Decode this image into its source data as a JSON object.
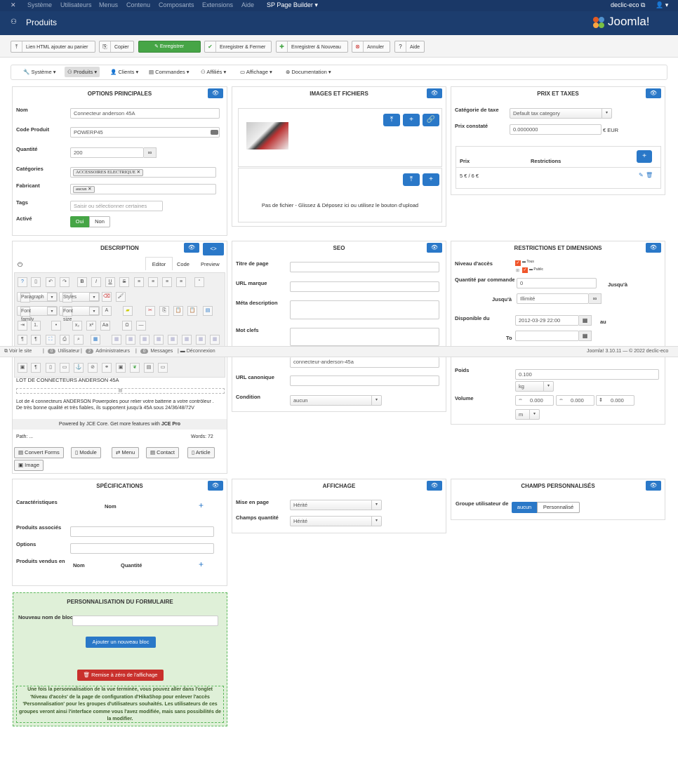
{
  "topbar": {
    "joomla_icon": "joomla-icon",
    "menu": [
      "Système",
      "Utilisateurs",
      "Menus",
      "Contenu",
      "Composants",
      "Extensions",
      "Aide"
    ],
    "sppb": "SP Page Builder",
    "site": "declic-eco",
    "user_icon": "user-icon"
  },
  "header": {
    "title": "Produits",
    "brand": "Joomla!"
  },
  "toolbar": {
    "html_cart": "Lien HTML ajouter au panier",
    "copy": "Copier",
    "save": "Enregistrer",
    "save_close": "Enregistrer & Fermer",
    "save_new": "Enregistrer & Nouveau",
    "cancel": "Annuler",
    "help": "Aide"
  },
  "nav": {
    "system": "Système",
    "products": "Produits",
    "clients": "Clients",
    "orders": "Commandes",
    "affiliates": "Affiliés",
    "display": "Affichage",
    "docs": "Documentation"
  },
  "main": {
    "title": "OPTIONS PRINCIPALES",
    "name_label": "Nom",
    "name_value": "Connecteur anderson 45A",
    "code_label": "Code Produit",
    "code_value": "POWERP45",
    "qty_label": "Quantité",
    "qty_value": "200",
    "cat_label": "Catégories",
    "cat_tag": "ACCESSOIRES ELECTRIQUE",
    "manuf_label": "Fabricant",
    "manuf_tag": "aucun",
    "tags_label": "Tags",
    "tags_placeholder": "Saisir ou sélectionner certaines",
    "active_label": "Activé",
    "yes": "Oui",
    "no": "Non"
  },
  "images": {
    "title": "IMAGES ET FICHIERS",
    "files_text": "Pas de fichier - Glissez & Déposez ici ou utilisez le bouton d'upload"
  },
  "price": {
    "title": "PRIX ET TAXES",
    "tax_label": "Catégorie de taxe",
    "tax_value": "Default tax category",
    "price_label": "Prix constaté",
    "price_value": "0.0000000",
    "currency": "€ EUR",
    "col_price": "Prix",
    "col_restrictions": "Restrictions",
    "row_price": "5 € / 6 €"
  },
  "description": {
    "title": "DESCRIPTION",
    "tab_editor": "Editor",
    "tab_code": "Code",
    "tab_preview": "Preview",
    "format": "Paragraph",
    "styles": "Styles",
    "font_family": "Font family",
    "font_size": "Font size",
    "heading": "LOT DE CONNECTEURS ANDERSON 45A",
    "body": "Lot de 4 connecteurs ANDERSON Powerpoles pour relier votre batterie a votre contrôleur . De très bonne qualité et très fiables, ils supportent jusqu'à 45A sous 24/36/48/72V",
    "powered": "Powered by JCE Core. Get more features with",
    "jce_pro": "JCE Pro",
    "path": "Path: ...",
    "words": "Words: 72",
    "btn_convert": "Convert Forms",
    "btn_module": "Module",
    "btn_menu": "Menu",
    "btn_contact": "Contact",
    "btn_article": "Article",
    "btn_image": "Image"
  },
  "seo": {
    "title": "SEO",
    "page_title_label": "Titre de page",
    "url_label": "URL marque",
    "meta_label": "Méta description",
    "keywords_label": "Mot clefs",
    "alias_value": "connecteur-anderson-45a",
    "canonical_label": "URL canonique",
    "condition_label": "Condition",
    "condition_value": "aucun"
  },
  "restrictions": {
    "title": "RESTRICTIONS ET DIMENSIONS",
    "access_label": "Niveau d'accès",
    "access_all": "Tous",
    "access_public": "Public",
    "qty_cmd_label": "Quantité par commande",
    "qty_min": "0",
    "until1": "Jusqu'à",
    "until2": "Jusqu'à",
    "qty_max": "Illimité",
    "avail_label": "Disponible du",
    "avail_date": "2012-03-29 22:00",
    "au": "au",
    "to": "To",
    "weight_label": "Poids",
    "weight_value": "0.100",
    "weight_unit": "kg",
    "volume_label": "Volume",
    "vol1": "0.000",
    "vol2": "0.000",
    "vol3": "0.000",
    "vol_unit": "m"
  },
  "status": {
    "view_site": "Voir le site",
    "users_count": "0",
    "users": "Utilisateur",
    "admins_count": "2",
    "admins": "Administrateurs",
    "msg_count": "0",
    "messages": "Messages",
    "logout": "Déconnexion",
    "version": "Joomla! 3.10.11 — © 2022 declic-eco"
  },
  "specs": {
    "title": "SPÉCIFICATIONS",
    "characteristics": "Caractéristiques",
    "name_col": "Nom",
    "related": "Produits associés",
    "options": "Options",
    "sold_with": "Produits vendus en",
    "name_col2": "Nom",
    "qty_col": "Quantité"
  },
  "affichage": {
    "title": "AFFICHAGE",
    "layout_label": "Mise en page",
    "layout_value": "Hérité",
    "qty_field_label": "Champs quantité",
    "qty_field_value": "Hérité"
  },
  "custom": {
    "title": "CHAMPS PERSONNALISÉS",
    "group_label": "Groupe utilisateur de",
    "none": "aucun",
    "custom": "Personnalisé"
  },
  "form": {
    "title": "PERSONNALISATION DU FORMULAIRE",
    "new_block_label": "Nouveau nom de bloc",
    "add_block": "Ajouter un nouveau bloc",
    "reset": "Remise à zéro de l'affichage",
    "note": "Une fois la personnalisation de la vue terminée, vous pouvez aller dans l'onglet 'Niveau d'accès' de la page de configuration d'HikaShop pour enlever l'accès 'Personnalisation' pour les groupes d'utilisateurs souhaités. Les utilisateurs de ces groupes veront ainsi l'interface comme vous l'avez modifiée, mais sans possibilités de la modifier."
  },
  "colors": {
    "primary": "#2a78c8",
    "success": "#46a546",
    "danger": "#c9302c",
    "header": "#1c3d6e"
  }
}
